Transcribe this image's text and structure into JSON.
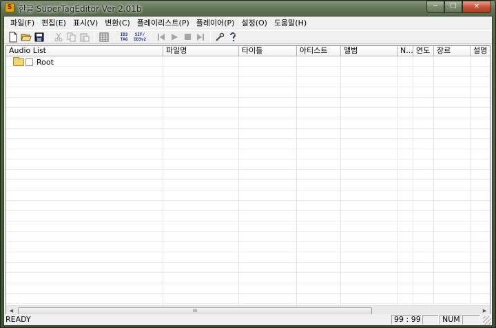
{
  "window": {
    "title_prefix": "한글",
    "title": "SuperTagEditor Ver 2.01b",
    "app_icon_glyph": "S",
    "buttons": {
      "minimize": "─",
      "maximize": "☐",
      "close": "✕"
    }
  },
  "menu": [
    {
      "label": "파일(F)"
    },
    {
      "label": "편집(E)"
    },
    {
      "label": "표시(V)"
    },
    {
      "label": "변환(C)"
    },
    {
      "label": "플레이리스트(P)"
    },
    {
      "label": "플레이어(P)"
    },
    {
      "label": "설정(O)"
    },
    {
      "label": "도움말(H)"
    }
  ],
  "toolbar": {
    "id3_tag": {
      "line1": "ID3",
      "line2": "TAG"
    },
    "sif_tag": {
      "line1": "SIF/",
      "line2": "ID3v2"
    }
  },
  "list": {
    "columns": [
      {
        "label": "Audio List"
      },
      {
        "label": "파일명"
      },
      {
        "label": "타이틀"
      },
      {
        "label": "아티스트"
      },
      {
        "label": "앨범"
      },
      {
        "label": "N..."
      },
      {
        "label": "연도"
      },
      {
        "label": "장르"
      },
      {
        "label": "설명"
      }
    ],
    "root_label": "Root",
    "root_checked": false
  },
  "scrollbar": {
    "thumb_grip": "III"
  },
  "status": {
    "text": "READY",
    "position": "99 : 99",
    "num": "NUM"
  },
  "colors": {
    "title_text": "#ffffff",
    "accent": "#0b2b9c",
    "disabled": "#a5a5a5"
  }
}
